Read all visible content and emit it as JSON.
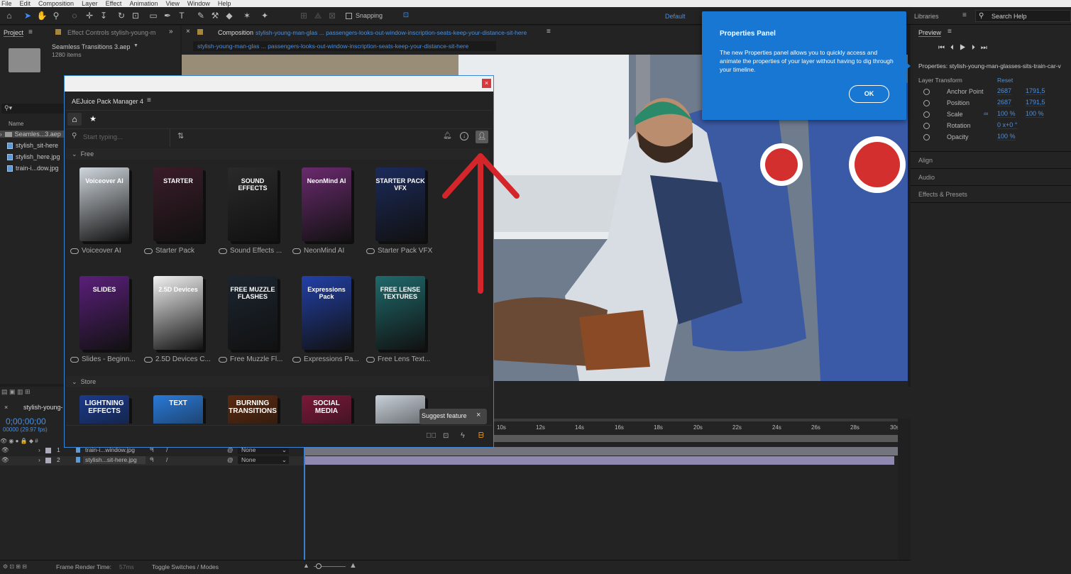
{
  "menu": [
    "File",
    "Edit",
    "Composition",
    "Layer",
    "Effect",
    "Animation",
    "View",
    "Window",
    "Help"
  ],
  "toolbar": {
    "snapping_label": "Snapping",
    "workspace": "Default",
    "libraries_tab": "Libraries",
    "search_help_placeholder": "Search Help"
  },
  "project_panel": {
    "tab_project": "Project",
    "tab_effect_controls": "Effect Controls stylish-young-m",
    "project_name": "Seamless Transitions 3.aep",
    "item_count": "1280 items",
    "column_name": "Name",
    "items": [
      "Seamles...3.aep",
      "stylish_sit-here",
      "stylish_here.jpg",
      "train-i...dow.jpg"
    ]
  },
  "composition": {
    "tab_label": "Composition",
    "comp_name": "stylish-young-man-glas ... passengers-looks-out-window-inscription-seats-keep-your-distance-sit-here",
    "subtab": "stylish-young-man-glas ... passengers-looks-out-window-inscription-seats-keep-your-distance-sit-here"
  },
  "callout": {
    "title": "Properties Panel",
    "body": "The new Properties panel allows you to quickly access and animate the properties of your layer without having to dig through your timeline.",
    "ok_label": "OK"
  },
  "right_panel": {
    "preview_tab": "Preview",
    "properties_title": "Properties: stylish-young-man-glasses-sits-train-car-v",
    "layer_transform": "Layer Transform",
    "reset": "Reset",
    "props": [
      {
        "name": "Anchor Point",
        "v1": "2687",
        "v2": "1791,5"
      },
      {
        "name": "Position",
        "v1": "2687",
        "v2": "1791,5"
      },
      {
        "name": "Scale",
        "v1": "100 %",
        "v2": "100 %"
      },
      {
        "name": "Rotation",
        "v1": "0 x+0 °",
        "v2": ""
      },
      {
        "name": "Opacity",
        "v1": "100 %",
        "v2": ""
      }
    ],
    "sections": [
      "Align",
      "Audio",
      "Effects & Presets"
    ]
  },
  "pack_manager": {
    "title": "AEJuice Pack Manager 4",
    "search_placeholder": "Start typing...",
    "section_free": "Free",
    "section_store": "Store",
    "free_packs": [
      {
        "label": "Voiceover AI",
        "box_title": "Voiceover AI",
        "color": "#cfd6dc"
      },
      {
        "label": "Starter Pack",
        "box_title": "STARTER",
        "color": "#3a1c28"
      },
      {
        "label": "Sound Effects ...",
        "box_title": "SOUND EFFECTS",
        "color": "#2a2a2a"
      },
      {
        "label": "NeonMind AI",
        "box_title": "NeonMind AI",
        "color": "#6a2a6e"
      },
      {
        "label": "Starter Pack VFX",
        "box_title": "STARTER PACK VFX",
        "color": "#1b2a5a"
      },
      {
        "label": "Slides - Beginn...",
        "box_title": "SLIDES",
        "color": "#5a1f7a"
      },
      {
        "label": "2.5D Devices C...",
        "box_title": "2.5D Devices",
        "color": "#f2f2f2"
      },
      {
        "label": "Free Muzzle Fl...",
        "box_title": "FREE MUZZLE FLASHES",
        "color": "#1c2530"
      },
      {
        "label": "Expressions Pa...",
        "box_title": "Expressions Pack",
        "color": "#2240a8"
      },
      {
        "label": "Free Lens Text...",
        "box_title": "FREE LENSE TEXTURES",
        "color": "#1f6a6c"
      }
    ],
    "store_packs": [
      {
        "box_title": "LIGHTNING EFFECTS",
        "color": "#1a3a8a"
      },
      {
        "box_title": "TEXT",
        "color": "#2a7ad8"
      },
      {
        "box_title": "BURNING TRANSITIONS",
        "color": "#5a2a10"
      },
      {
        "box_title": "SOCIAL MEDIA",
        "color": "#7a1838"
      },
      {
        "box_title": "",
        "color": "#c8d0d8"
      }
    ],
    "suggest_feature": "Suggest feature"
  },
  "timeline": {
    "comp_tab": "stylish-young-",
    "timecode": "0;00;00;00",
    "fps": "00000 (29.97 fps)",
    "ruler": [
      "10s",
      "12s",
      "14s",
      "16s",
      "18s",
      "20s",
      "22s",
      "24s",
      "26s",
      "28s",
      "30s"
    ],
    "layers": [
      {
        "num": "1",
        "name": "train-i...window.jpg",
        "parent": "None"
      },
      {
        "num": "2",
        "name": "stylish...sit-here.jpg",
        "parent": "None"
      }
    ],
    "frame_render_label": "Frame Render Time:",
    "frame_render_value": "57ms",
    "toggle_label": "Toggle Switches / Modes"
  },
  "colors": {
    "accent": "#1777d3",
    "arrow": "#d4262a",
    "link_blue": "#4a90e2"
  }
}
